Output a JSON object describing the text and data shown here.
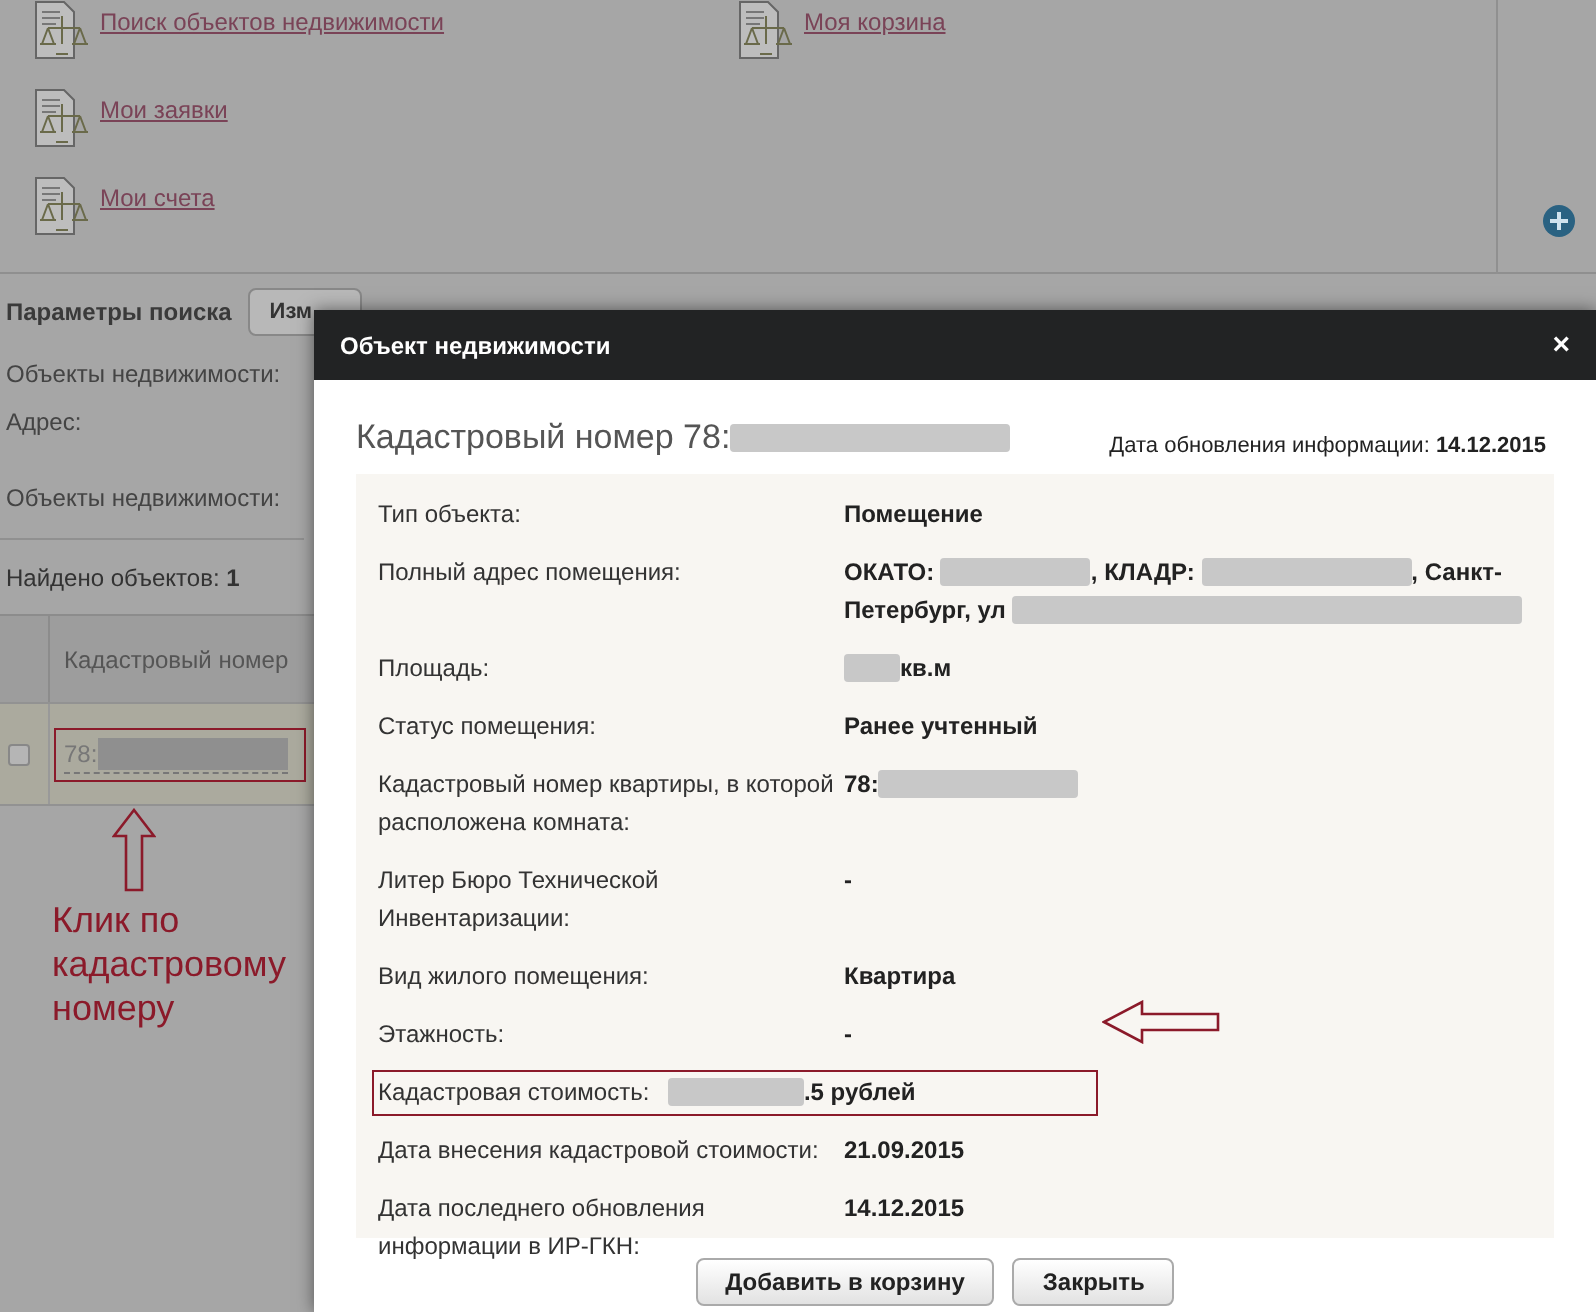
{
  "background_page": {
    "nav_links": [
      {
        "label": "Поиск объектов недвижимости"
      },
      {
        "label": "Моя корзина"
      },
      {
        "label": "Мои заявки"
      },
      {
        "label": "Мои счета"
      }
    ],
    "search_params": {
      "title": "Параметры поиска",
      "button": "Изм"
    },
    "filters": [
      {
        "label": "Объекты недвижимости:"
      },
      {
        "label": "Адрес:"
      },
      {
        "label": "Объекты недвижимости:"
      }
    ],
    "found": "Найдено объектов: **1**",
    "table": {
      "columns": [
        "Кадастровый номер"
      ],
      "rows": [
        {
          "checked": false,
          "highlighted": true,
          "cadastral_number": [
            {
              "kind": "text",
              "text": "78:"
            },
            {
              "kind": "redaction"
            }
          ]
        }
      ]
    }
  },
  "annotation": {
    "text": "Клик по кадастровому номеру"
  },
  "dialog": {
    "title": "Объект недвижимости",
    "close": "×",
    "heading": [
      {
        "kind": "text",
        "text": "Кадастровый номер 78:"
      },
      {
        "kind": "redaction"
      }
    ],
    "updated": "Дата обновления информации: **14.12.2015**",
    "fields": [
      {
        "label": "Тип объекта:",
        "highlighted": false,
        "value": [
          {
            "kind": "text",
            "text": "Помещение"
          }
        ]
      },
      {
        "label": "Полный адрес помещения:",
        "highlighted": false,
        "value": [
          {
            "kind": "text",
            "text": "ОКАТО: "
          },
          {
            "kind": "redaction"
          },
          {
            "kind": "text",
            "text": ", КЛАДР: "
          },
          {
            "kind": "redaction"
          },
          {
            "kind": "text",
            "text": ", Санкт-"
          },
          {
            "kind": "text",
            "text": "Петербург, ул "
          },
          {
            "kind": "redaction"
          }
        ]
      },
      {
        "label": "Площадь:",
        "highlighted": false,
        "value": [
          {
            "kind": "redaction"
          },
          {
            "kind": "text",
            "text": "кв.м"
          }
        ]
      },
      {
        "label": "Статус помещения:",
        "highlighted": false,
        "value": [
          {
            "kind": "text",
            "text": "Ранее учтенный"
          }
        ]
      },
      {
        "label": "Кадастровый номер квартиры, в которой расположена комната:",
        "highlighted": false,
        "value": [
          {
            "kind": "text",
            "text": "78:"
          },
          {
            "kind": "redaction"
          }
        ]
      },
      {
        "label": "Литер Бюро Технической Инвентаризации:",
        "highlighted": false,
        "value": [
          {
            "kind": "text",
            "text": "-"
          }
        ]
      },
      {
        "label": "Вид жилого помещения:",
        "highlighted": false,
        "value": [
          {
            "kind": "text",
            "text": "Квартира"
          }
        ]
      },
      {
        "label": "Этажность:",
        "highlighted": false,
        "value": [
          {
            "kind": "text",
            "text": "-"
          }
        ]
      },
      {
        "label": "Кадастровая стоимость:",
        "highlighted": true,
        "value": [
          {
            "kind": "redaction"
          },
          {
            "kind": "text",
            "text": ".5 рублей"
          }
        ]
      },
      {
        "label": "Дата внесения кадастровой стоимости:",
        "highlighted": false,
        "value": [
          {
            "kind": "text",
            "text": "21.09.2015"
          }
        ]
      },
      {
        "label": "Дата последнего обновления информации в ИР-ГКН:",
        "highlighted": false,
        "value": [
          {
            "kind": "text",
            "text": "14.12.2015"
          }
        ]
      }
    ],
    "buttons": [
      "Добавить в корзину",
      "Закрыть"
    ]
  }
}
